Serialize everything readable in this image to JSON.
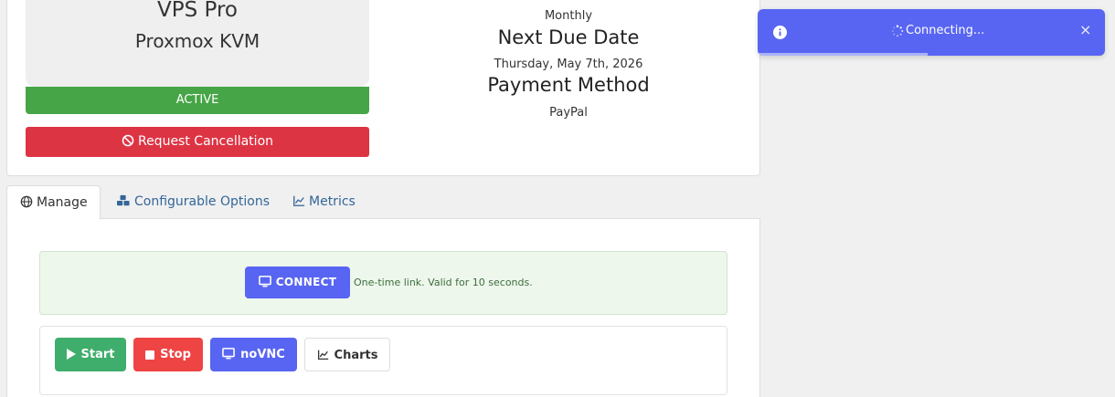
{
  "product": {
    "name": "VPS Pro",
    "group": "Proxmox KVM",
    "status": "ACTIVE",
    "cancel_label": "Request Cancellation"
  },
  "billing": {
    "cycle": "Monthly",
    "due_heading": "Next Due Date",
    "due_date": "Thursday, May 7th, 2026",
    "payment_heading": "Payment Method",
    "payment_method": "PayPal"
  },
  "tabs": [
    {
      "label": "Manage",
      "icon": "globe-icon",
      "active": true
    },
    {
      "label": "Configurable Options",
      "icon": "cubes-icon",
      "active": false
    },
    {
      "label": "Metrics",
      "icon": "line-chart-icon",
      "active": false
    }
  ],
  "connect": {
    "button_label": "CONNECT",
    "note": "One-time link. Valid for 10 seconds."
  },
  "actions": {
    "start_label": "Start",
    "stop_label": "Stop",
    "novnc_label": "noVNC",
    "charts_label": "Charts"
  },
  "toast": {
    "message": "Connecting...",
    "close_glyph": "×",
    "progress": 0.49
  },
  "colors": {
    "status_active": "#46a546",
    "danger": "#dd3444",
    "primary": "#5865f2",
    "success": "#3fae6c",
    "stop": "#ef4444",
    "link": "#336699"
  }
}
